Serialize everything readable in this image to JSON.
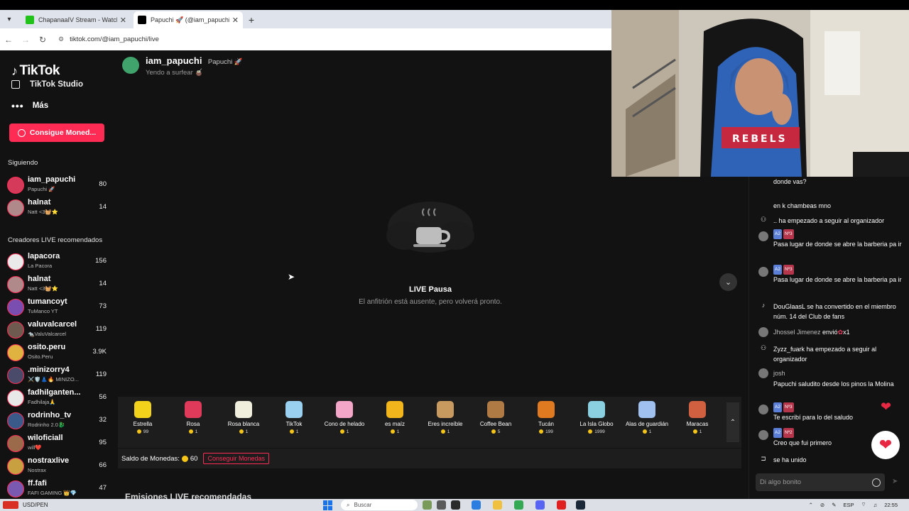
{
  "browser": {
    "tabs": [
      {
        "title": "ChapanaaIV Stream - Watch Li...",
        "fav_color": "#21c21a",
        "active": false
      },
      {
        "title": "Papuchi 🚀 (@iam_papuchi) es...",
        "fav_color": "#000000",
        "active": true
      }
    ],
    "url": "tiktok.com/@iam_papuchi/live"
  },
  "sidebar": {
    "logo": "TikTok",
    "studio": "TikTok Studio",
    "more": "Más",
    "coins_button": "Consigue Moned...",
    "following_title": "Siguiendo",
    "following": [
      {
        "name": "iam_papuchi",
        "sub": "Papuchi 🚀",
        "count": "80",
        "color": "#d63a5a"
      },
      {
        "name": "halnat",
        "sub": "Natt <3🧺⭐",
        "count": "14",
        "color": "#b08a8a"
      }
    ],
    "recommended_title": "Creadores LIVE recomendados",
    "recommended": [
      {
        "name": "lapacora",
        "sub": "La Pacora",
        "count": "156",
        "color": "#eaeaea"
      },
      {
        "name": "halnat",
        "sub": "Natt <3🧺⭐",
        "count": "14",
        "color": "#b08a8a"
      },
      {
        "name": "tumancoyt",
        "sub": "TuManco YT",
        "count": "73",
        "color": "#7a4db0"
      },
      {
        "name": "valuvalcarcel",
        "sub": "🐀ValuValcarcel",
        "count": "119",
        "color": "#6e5a4e"
      },
      {
        "name": "osito.peru",
        "sub": "Osito.Peru",
        "count": "3.9K",
        "color": "#e0b340"
      },
      {
        "name": ".minizorry4",
        "sub": "⚔️🛡️👗🔥 MINIZO...",
        "count": "119",
        "color": "#4a4a6a"
      },
      {
        "name": "fadhilganten...",
        "sub": "Fadhilaja🙏",
        "count": "56",
        "color": "#e8e8e8"
      },
      {
        "name": "rodrinho_tv",
        "sub": "Rodrinho 2.0🐉",
        "count": "32",
        "color": "#3a5a8a"
      },
      {
        "name": "wiloficiall",
        "sub": "will❤️",
        "count": "95",
        "color": "#9a6a4a"
      },
      {
        "name": "nostraxlive",
        "sub": "Nostrax",
        "count": "66",
        "color": "#c8a040"
      },
      {
        "name": "ff.fafi",
        "sub": "FAFI GAMING 👑💎",
        "count": "47",
        "color": "#7a5ab0"
      }
    ]
  },
  "stream": {
    "host_name": "iam_papuchi",
    "host_nick": "Papuchi 🚀",
    "title": "Yendo a surfear 🧉",
    "pause_title": "LIVE Pausa",
    "pause_sub": "El anfitrión está ausente, pero volverá pronto."
  },
  "gifts": [
    {
      "name": "Estrella",
      "price": "99",
      "color": "#f2d21b"
    },
    {
      "name": "Rosa",
      "price": "1",
      "color": "#e03a5a"
    },
    {
      "name": "Rosa blanca",
      "price": "1",
      "color": "#f0eedd"
    },
    {
      "name": "TikTok",
      "price": "1",
      "color": "#9ad0f0"
    },
    {
      "name": "Cono de helado",
      "price": "1",
      "color": "#f4a6c8"
    },
    {
      "name": "es maíz",
      "price": "1",
      "color": "#f2b51b"
    },
    {
      "name": "Eres increíble",
      "price": "1",
      "color": "#c99a60"
    },
    {
      "name": "Coffee Bean",
      "price": "5",
      "color": "#b07a45"
    },
    {
      "name": "Tucán",
      "price": "199",
      "color": "#e07a20"
    },
    {
      "name": "La Isla Globo",
      "price": "1999",
      "color": "#8ad0e0"
    },
    {
      "name": "Alas de guardián",
      "price": "1",
      "color": "#a0c0f0"
    },
    {
      "name": "Maracas",
      "price": "1",
      "color": "#d06040"
    }
  ],
  "balance": {
    "label": "Saldo de Monedas:",
    "amount": "60",
    "get_button": "Conseguir Monedas"
  },
  "recommended_streams": "Emisiones LIVE recomendadas",
  "chat": {
    "messages": [
      {
        "kind": "text",
        "text": "donde vas?"
      },
      {
        "kind": "text",
        "text": "en k chambeas mno"
      },
      {
        "kind": "system",
        "icon": "follow",
        "text": ".. ha empezado a seguir al organizador"
      },
      {
        "kind": "badged",
        "b1": "A2",
        "b2": "Nº3",
        "text": "Pasa lugar de donde se abre la barberia pa ir"
      },
      {
        "kind": "badged",
        "b1": "A2",
        "b2": "Nº3",
        "text": "Pasa lugar de donde se abre la barberia pa ir"
      },
      {
        "kind": "system",
        "icon": "tiktok",
        "text": "DouGlaasL se ha convertido en el miembro núm. 14 del Club de fans"
      },
      {
        "kind": "gift",
        "name": "Jhossel Jimenez",
        "text": "envió",
        "suffix": "x1"
      },
      {
        "kind": "system",
        "icon": "follow",
        "text": "Zyzz_fuark ha empezado a seguir al organizador"
      },
      {
        "kind": "named",
        "name": "josh",
        "text": "Papuchi saludito desde los pinos la Molina"
      },
      {
        "kind": "badged",
        "b1": "A2",
        "b2": "Nº3",
        "text": "Te escribí para lo del saludo"
      },
      {
        "kind": "badged",
        "b1": "A2",
        "b2": "Nº2",
        "text": "Creo que fui primero"
      },
      {
        "kind": "system",
        "icon": "join",
        "text": "se ha unido"
      }
    ],
    "input_placeholder": "Di algo bonito"
  },
  "taskbar": {
    "left": "USD/PEN",
    "search": "Buscar",
    "lang": "ESP",
    "time": "22:55"
  }
}
